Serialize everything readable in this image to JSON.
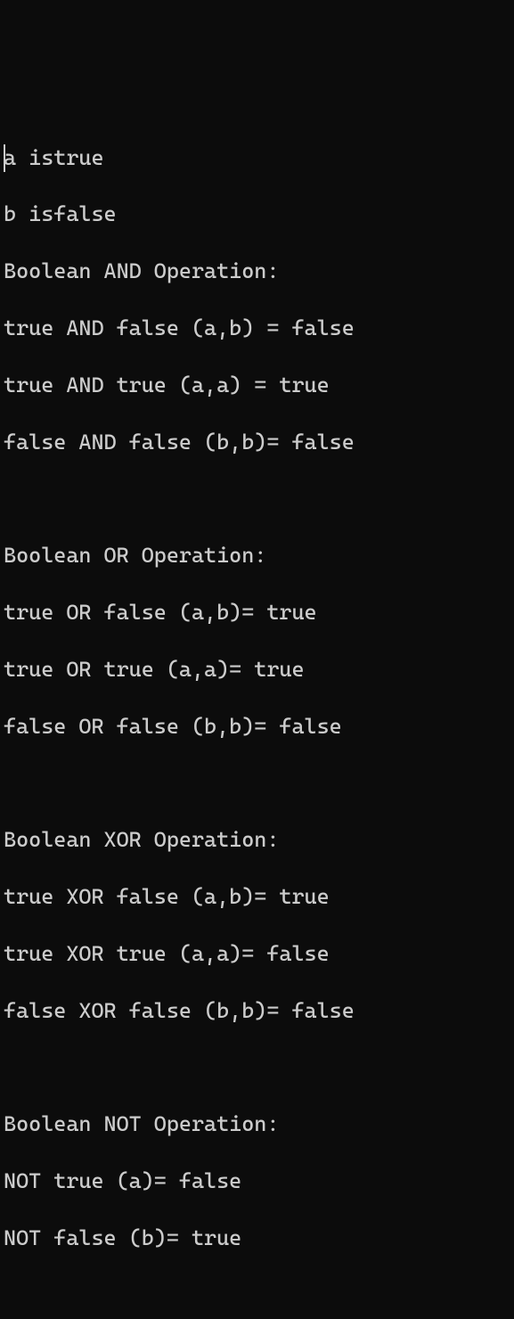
{
  "terminal": {
    "lines": [
      "a istrue",
      "b isfalse",
      "Boolean AND Operation:",
      "true AND false (a,b) = false",
      "true AND true (a,a) = true",
      "false AND false (b,b)= false",
      "",
      "Boolean OR Operation:",
      "true OR false (a,b)= true",
      "true OR true (a,a)= true",
      "false OR false (b,b)= false",
      "",
      "Boolean XOR Operation:",
      "true XOR false (a,b)= true",
      "true XOR true (a,a)= false",
      "false XOR false (b,b)= false",
      "",
      "Boolean NOT Operation:",
      "NOT true (a)= false",
      "NOT false (b)= true"
    ]
  }
}
